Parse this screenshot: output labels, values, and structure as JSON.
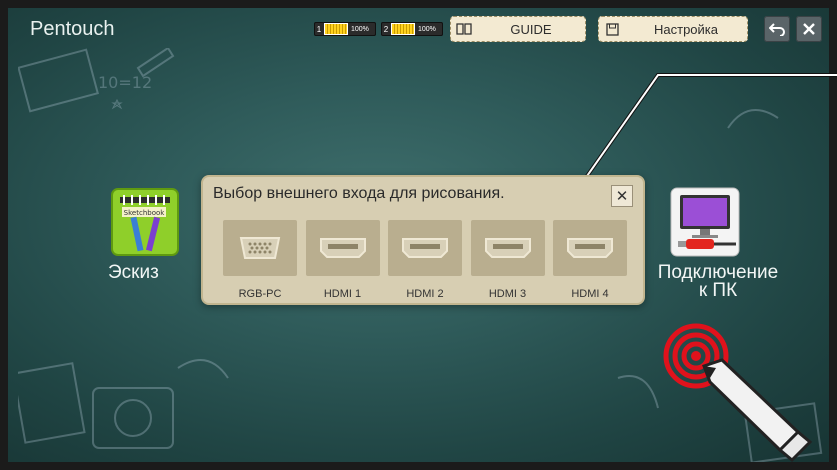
{
  "app": {
    "title": "Pentouch"
  },
  "toolbar": {
    "battery1": {
      "index": "1",
      "percent": "100%"
    },
    "battery2": {
      "index": "2",
      "percent": "100%"
    },
    "guide_label": "GUIDE",
    "settings_label": "Настройка",
    "back_icon": "back-arrow-icon",
    "close_icon": "close-icon"
  },
  "apps": {
    "sketch": {
      "label": "Эскиз",
      "icon": "sketchbook-icon",
      "badge": "Sketchbook"
    },
    "pc": {
      "label_line1": "Подключение",
      "label_line2": "к ПК",
      "icon": "monitor-plug-icon"
    }
  },
  "dialog": {
    "title": "Выбор внешнего входа для рисования.",
    "inputs": [
      {
        "label": "RGB-PC",
        "icon": "vga-port-icon"
      },
      {
        "label": "HDMI 1",
        "icon": "hdmi-port-icon"
      },
      {
        "label": "HDMI 2",
        "icon": "hdmi-port-icon"
      },
      {
        "label": "HDMI 3",
        "icon": "hdmi-port-icon"
      },
      {
        "label": "HDMI 4",
        "icon": "hdmi-port-icon"
      }
    ]
  },
  "colors": {
    "board": "#2f5b5a",
    "dialog": "#d7ceb2",
    "accent_red": "#e0121c"
  }
}
